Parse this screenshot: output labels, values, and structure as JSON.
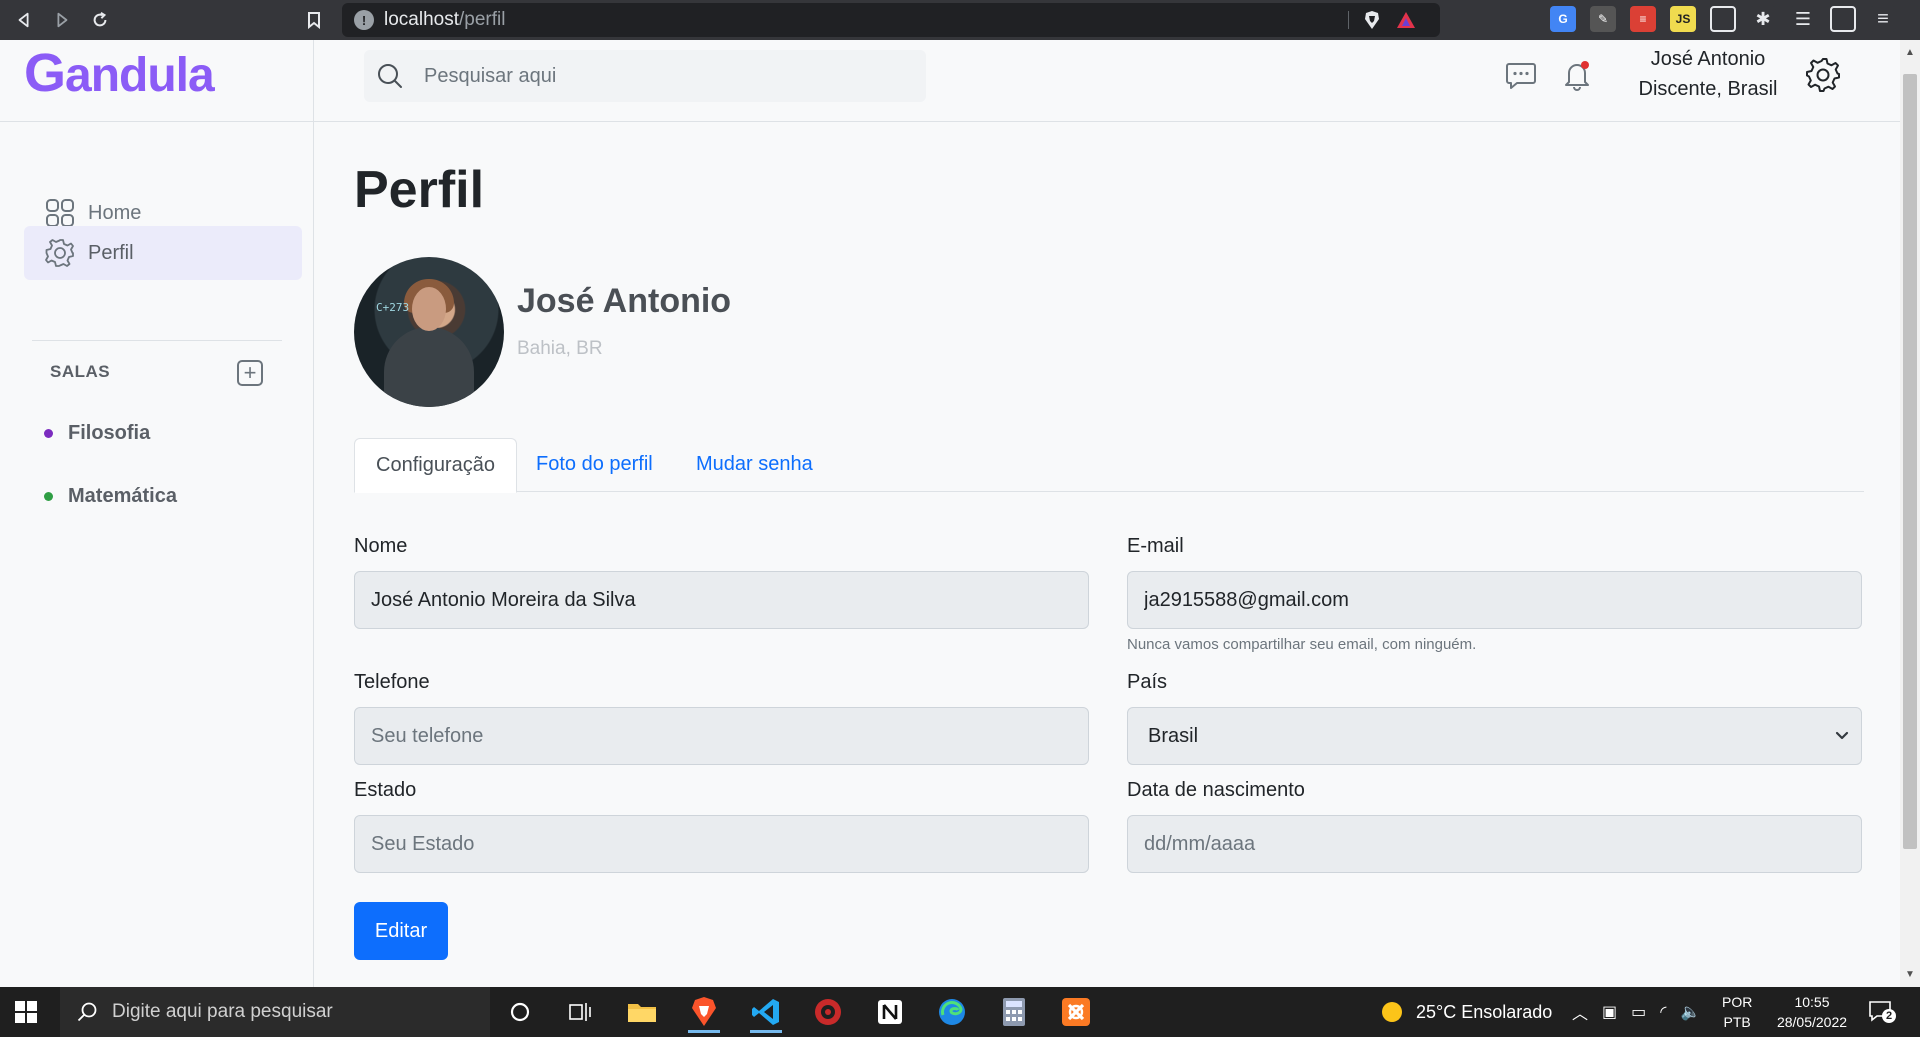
{
  "browser": {
    "url_host": "localhost",
    "url_path": "/perfil",
    "site_info_glyph": "!"
  },
  "app": {
    "logo_initial": "G",
    "logo_rest": "andula",
    "brand_color": "#8b5cf6"
  },
  "header": {
    "search_placeholder": "Pesquisar aqui",
    "user_name": "José Antonio",
    "user_role": "Discente, Brasil"
  },
  "sidebar": {
    "items": [
      {
        "label": "Home",
        "icon": "grid-icon"
      },
      {
        "label": "Perfil",
        "icon": "gear-icon"
      }
    ],
    "salas_title": "SALAS",
    "add_glyph": "+",
    "rooms": [
      {
        "label": "Filosofia",
        "color": "#7b2cbf"
      },
      {
        "label": "Matemática",
        "color": "#2f9e44"
      }
    ]
  },
  "page": {
    "title": "Perfil",
    "profile_name": "José Antonio",
    "profile_location": "Bahia, BR",
    "avatar_overlay_text": "C+273"
  },
  "tabs": [
    {
      "label": "Configuração",
      "active": true
    },
    {
      "label": "Foto do perfil",
      "active": false
    },
    {
      "label": "Mudar senha",
      "active": false
    }
  ],
  "form": {
    "nome_label": "Nome",
    "nome_value": "José Antonio Moreira da Silva",
    "email_label": "E-mail",
    "email_value": "ja2915588@gmail.com",
    "email_help": "Nunca vamos compartilhar seu email, com ninguém.",
    "telefone_label": "Telefone",
    "telefone_placeholder": "Seu telefone",
    "pais_label": "País",
    "pais_value": "Brasil",
    "estado_label": "Estado",
    "estado_placeholder": "Seu Estado",
    "nascimento_label": "Data de nascimento",
    "nascimento_placeholder": "dd/mm/aaaa",
    "edit_button": "Editar"
  },
  "taskbar": {
    "search_placeholder": "Digite aqui para pesquisar",
    "weather": "25°C  Ensolarado",
    "lang_top": "POR",
    "lang_bottom": "PTB",
    "time": "10:55",
    "date": "28/05/2022",
    "notification_count": "2"
  },
  "colors": {
    "primary": "#0d6efd",
    "active_nav_bg": "#ebebfa"
  }
}
